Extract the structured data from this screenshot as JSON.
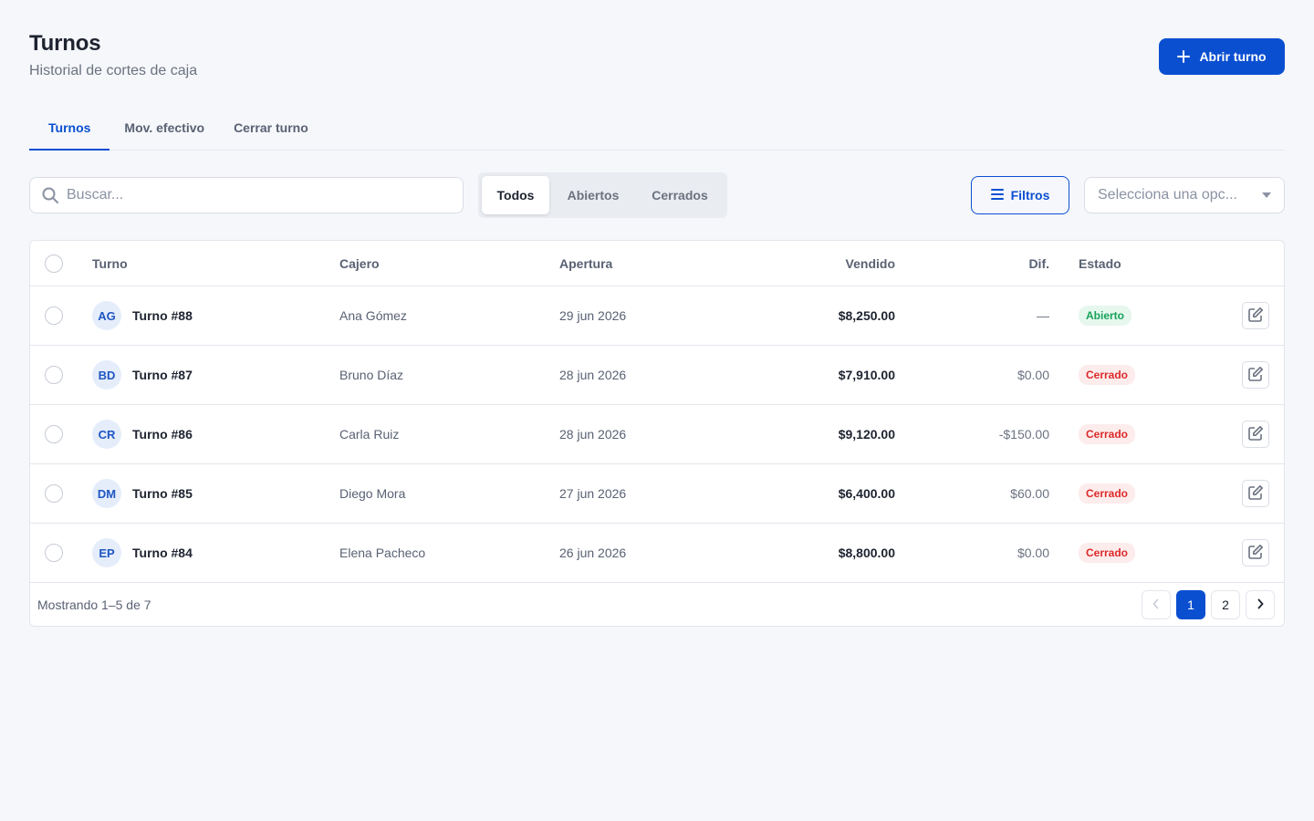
{
  "header": {
    "title": "Turnos",
    "subtitle": "Historial de cortes de caja",
    "primary_button": "Abrir turno"
  },
  "tabs": [
    {
      "label": "Turnos",
      "active": true
    },
    {
      "label": "Mov. efectivo",
      "active": false
    },
    {
      "label": "Cerrar turno",
      "active": false
    }
  ],
  "toolbar": {
    "search_placeholder": "Buscar...",
    "segments": [
      {
        "label": "Todos",
        "active": true
      },
      {
        "label": "Abiertos",
        "active": false
      },
      {
        "label": "Cerrados",
        "active": false
      }
    ],
    "filters_label": "Filtros",
    "select_placeholder": "Selecciona una opc..."
  },
  "table": {
    "columns": [
      "Turno",
      "Cajero",
      "Apertura",
      "Vendido",
      "Dif.",
      "Estado"
    ],
    "rows": [
      {
        "initials": "AG",
        "turn": "Turno #88",
        "cashier": "Ana Gómez",
        "opened": "29 jun 2026",
        "sold": "$8,250.00",
        "diff": "—",
        "status": "Abierto",
        "status_type": "open"
      },
      {
        "initials": "BD",
        "turn": "Turno #87",
        "cashier": "Bruno Díaz",
        "opened": "28 jun 2026",
        "sold": "$7,910.00",
        "diff": "$0.00",
        "status": "Cerrado",
        "status_type": "closed"
      },
      {
        "initials": "CR",
        "turn": "Turno #86",
        "cashier": "Carla Ruiz",
        "opened": "28 jun 2026",
        "sold": "$9,120.00",
        "diff": "-$150.00",
        "status": "Cerrado",
        "status_type": "closed"
      },
      {
        "initials": "DM",
        "turn": "Turno #85",
        "cashier": "Diego Mora",
        "opened": "27 jun 2026",
        "sold": "$6,400.00",
        "diff": "$60.00",
        "status": "Cerrado",
        "status_type": "closed"
      },
      {
        "initials": "EP",
        "turn": "Turno #84",
        "cashier": "Elena Pacheco",
        "opened": "26 jun 2026",
        "sold": "$8,800.00",
        "diff": "$0.00",
        "status": "Cerrado",
        "status_type": "closed"
      }
    ],
    "footer": "Mostrando 1–5 de 7",
    "pages": [
      "1",
      "2"
    ],
    "current_page": "1"
  },
  "colors": {
    "accent": "#0b4fd1",
    "open_badge": "#16a35a",
    "closed_badge": "#dc2a2a",
    "background": "#f5f7fa"
  },
  "icons": {
    "primary_button": "plus-icon",
    "search": "search-icon",
    "filters": "menu-icon",
    "select": "caret-down-icon",
    "row_action": "edit-icon",
    "pager_prev": "chevron-left-icon",
    "pager_next": "chevron-right-icon"
  }
}
